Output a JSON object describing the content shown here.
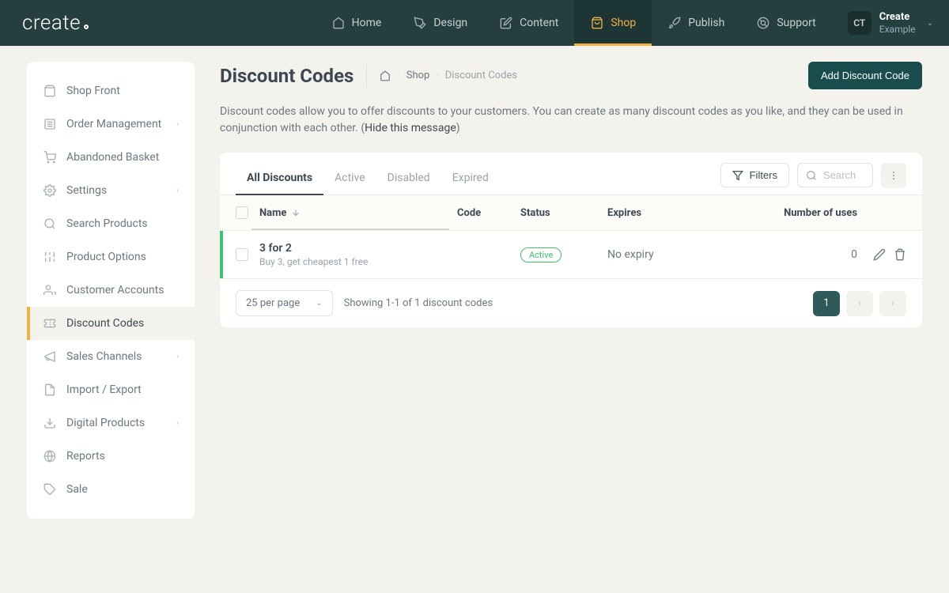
{
  "brand": "create",
  "nav": {
    "home": "Home",
    "design": "Design",
    "content": "Content",
    "shop": "Shop",
    "publish": "Publish",
    "support": "Support"
  },
  "user": {
    "initials": "CT",
    "name": "Create",
    "sub": "Example"
  },
  "sidebar": {
    "shop_front": "Shop Front",
    "order_mgmt": "Order Management",
    "abandoned": "Abandoned Basket",
    "settings": "Settings",
    "search_products": "Search Products",
    "product_options": "Product Options",
    "customer_accounts": "Customer Accounts",
    "discount_codes": "Discount Codes",
    "sales_channels": "Sales Channels",
    "import_export": "Import / Export",
    "digital_products": "Digital Products",
    "reports": "Reports",
    "sale": "Sale"
  },
  "page": {
    "title": "Discount Codes",
    "crumb_shop": "Shop",
    "crumb_current": "Discount Codes",
    "add_button": "Add Discount Code",
    "intro_pre": "Discount codes allow you to offer discounts to your customers. You can create as many discount codes as you like, and they can be used in conjunction with each other. (",
    "intro_hide": "Hide this message",
    "intro_post": ")"
  },
  "tabs": {
    "all": "All Discounts",
    "active": "Active",
    "disabled": "Disabled",
    "expired": "Expired"
  },
  "controls": {
    "filters": "Filters",
    "search_placeholder": "Search"
  },
  "table": {
    "headers": {
      "name": "Name",
      "code": "Code",
      "status": "Status",
      "expires": "Expires",
      "uses": "Number of uses"
    },
    "rows": [
      {
        "name": "3 for 2",
        "sub": "Buy 3, get cheapest 1 free",
        "code": "",
        "status": "Active",
        "expires": "No expiry",
        "uses": "0"
      }
    ]
  },
  "footer": {
    "per_page": "25 per page",
    "showing": "Showing 1-1 of 1 discount codes",
    "page": "1"
  }
}
